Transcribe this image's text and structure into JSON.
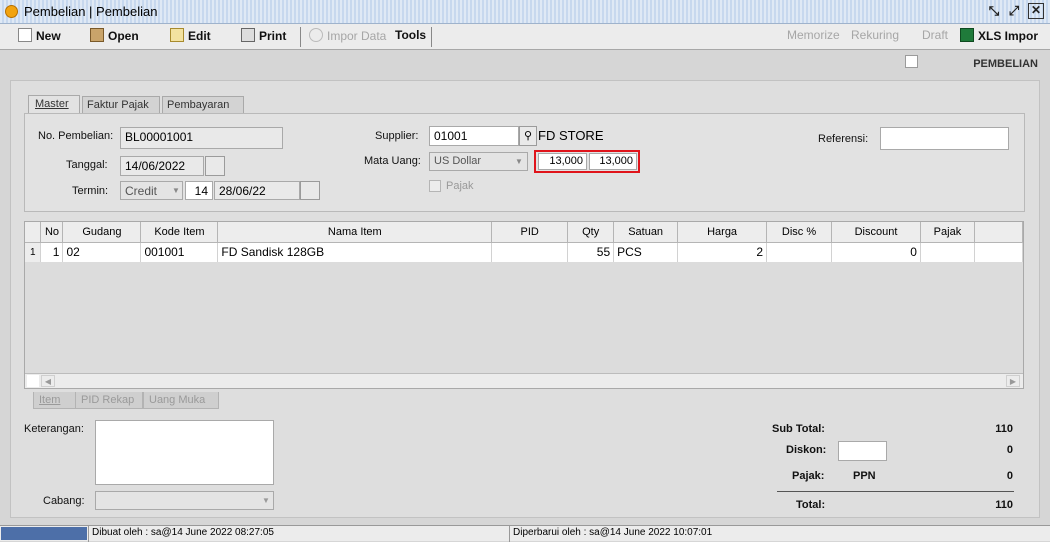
{
  "window": {
    "title": "Pembelian | Pembelian"
  },
  "toolbar": {
    "new": "New",
    "open": "Open",
    "edit": "Edit",
    "print": "Print",
    "impor_data": "Impor Data",
    "tools": "Tools",
    "memorize": "Memorize",
    "rekuring": "Rekuring",
    "draft": "Draft",
    "xls_impor": "XLS Impor"
  },
  "page_heading": "PEMBELIAN",
  "tabs": [
    "Master",
    "Faktur Pajak",
    "Pembayaran"
  ],
  "form": {
    "no_pembelian_label": "No. Pembelian:",
    "no_pembelian": "BL00001001",
    "tanggal_label": "Tanggal:",
    "tanggal": "14/06/2022",
    "termin_label": "Termin:",
    "termin": "Credit",
    "termin_days": "14",
    "termin_date": "28/06/22",
    "supplier_label": "Supplier:",
    "supplier_code": "01001",
    "supplier_name": "FD STORE",
    "mata_uang_label": "Mata Uang:",
    "mata_uang": "US Dollar",
    "kurs1": "13,000",
    "kurs2": "13,000",
    "pajak_label": "Pajak",
    "referensi_label": "Referensi:",
    "referensi": ""
  },
  "grid": {
    "columns": [
      "No",
      "Gudang",
      "Kode Item",
      "Nama Item",
      "PID",
      "Qty",
      "Satuan",
      "Harga",
      "Disc %",
      "Discount",
      "Pajak"
    ],
    "rows": [
      {
        "row_num": "1",
        "no": "1",
        "gudang": "02",
        "kode_item": "001001",
        "nama_item": "FD Sandisk 128GB",
        "pid": "",
        "qty": "55",
        "satuan": "PCS",
        "harga": "2",
        "disc_pct": "",
        "discount": "0",
        "pajak": ""
      }
    ]
  },
  "bottom_tabs": [
    "Item",
    "PID Rekap",
    "Uang Muka"
  ],
  "bottom": {
    "keterangan_label": "Keterangan:",
    "cabang_label": "Cabang:",
    "sub_total_label": "Sub Total:",
    "sub_total": "110",
    "diskon_label": "Diskon:",
    "diskon": "0",
    "pajak_label": "Pajak:",
    "pajak_name": "PPN",
    "pajak": "0",
    "total_label": "Total:",
    "total": "110"
  },
  "status": {
    "dibuat": "Dibuat oleh : sa@14 June 2022  08:27:05",
    "diperbarui": "Diperbarui oleh : sa@14 June 2022  10:07:01"
  },
  "colors": {
    "highlight_box": "#e0141b",
    "accent_blue": "#4d6fa8"
  }
}
